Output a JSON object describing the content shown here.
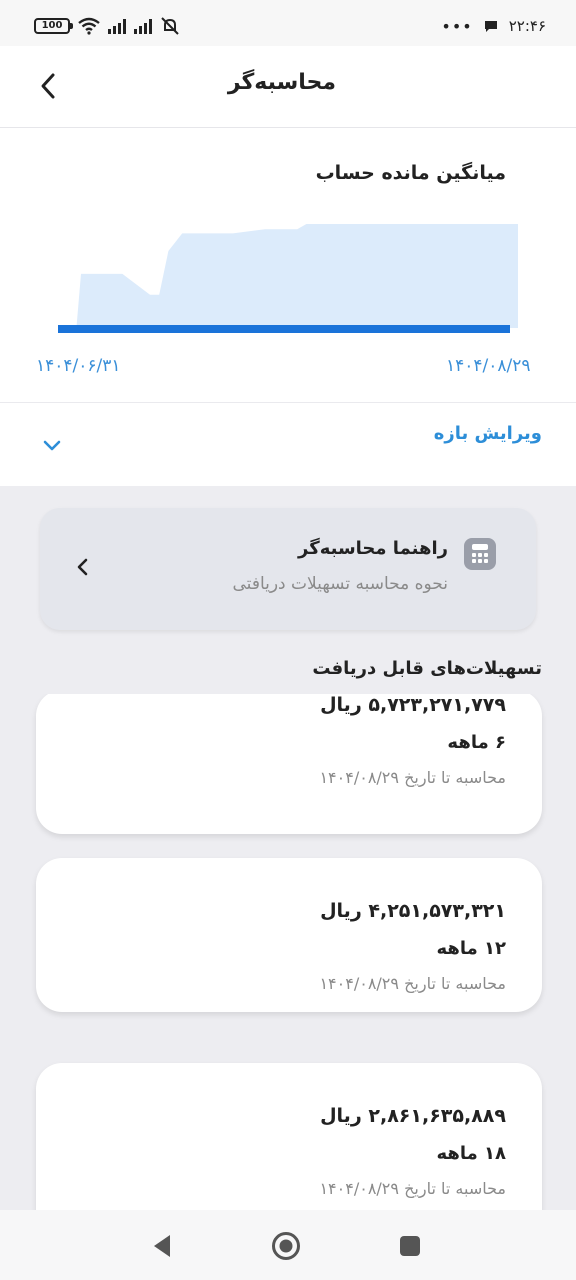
{
  "status_bar": {
    "time": "۲۲:۴۶",
    "battery": "100",
    "dots": "•••"
  },
  "header": {
    "title": "محاسبه‌گر"
  },
  "chart": {
    "title": "میانگین مانده حساب",
    "date_start": "۱۴۰۴/۰۶/۳۱",
    "date_end": "۱۴۰۴/۰۸/۲۹",
    "fill_color": "#dcebfb",
    "line_color": "#1a73d9"
  },
  "chart_data": {
    "type": "area",
    "x": [
      "۱۴۰۴/۰۶/۳۱",
      "۱۴۰۴/۰۸/۲۹"
    ],
    "relative_values": [
      0.0,
      0.52,
      0.52,
      0.32,
      0.32,
      0.74,
      0.91,
      0.91,
      0.95,
      0.95,
      1.0,
      1.0
    ]
  },
  "range": {
    "label": "ویرایش بازه"
  },
  "guide": {
    "title": "راهنما محاسبه‌گر",
    "subtitle": "نحوه محاسبه تسهیلات دریافتی"
  },
  "loans_section": {
    "title": "تسهیلات‌های قابل دریافت",
    "items": [
      {
        "amount": "۵,۷۲۳,۲۷۱,۷۷۹ ریال",
        "term": "۶ ماهه",
        "date_note": "محاسبه تا تاریخ ۱۴۰۴/۰۸/۲۹"
      },
      {
        "amount": "۴,۲۵۱,۵۷۳,۳۲۱ ریال",
        "term": "۱۲ ماهه",
        "date_note": "محاسبه تا تاریخ ۱۴۰۴/۰۸/۲۹"
      },
      {
        "amount": "۲,۸۶۱,۶۳۵,۸۸۹ ریال",
        "term": "۱۸ ماهه",
        "date_note": "محاسبه تا تاریخ ۱۴۰۴/۰۸/۲۹"
      }
    ]
  }
}
